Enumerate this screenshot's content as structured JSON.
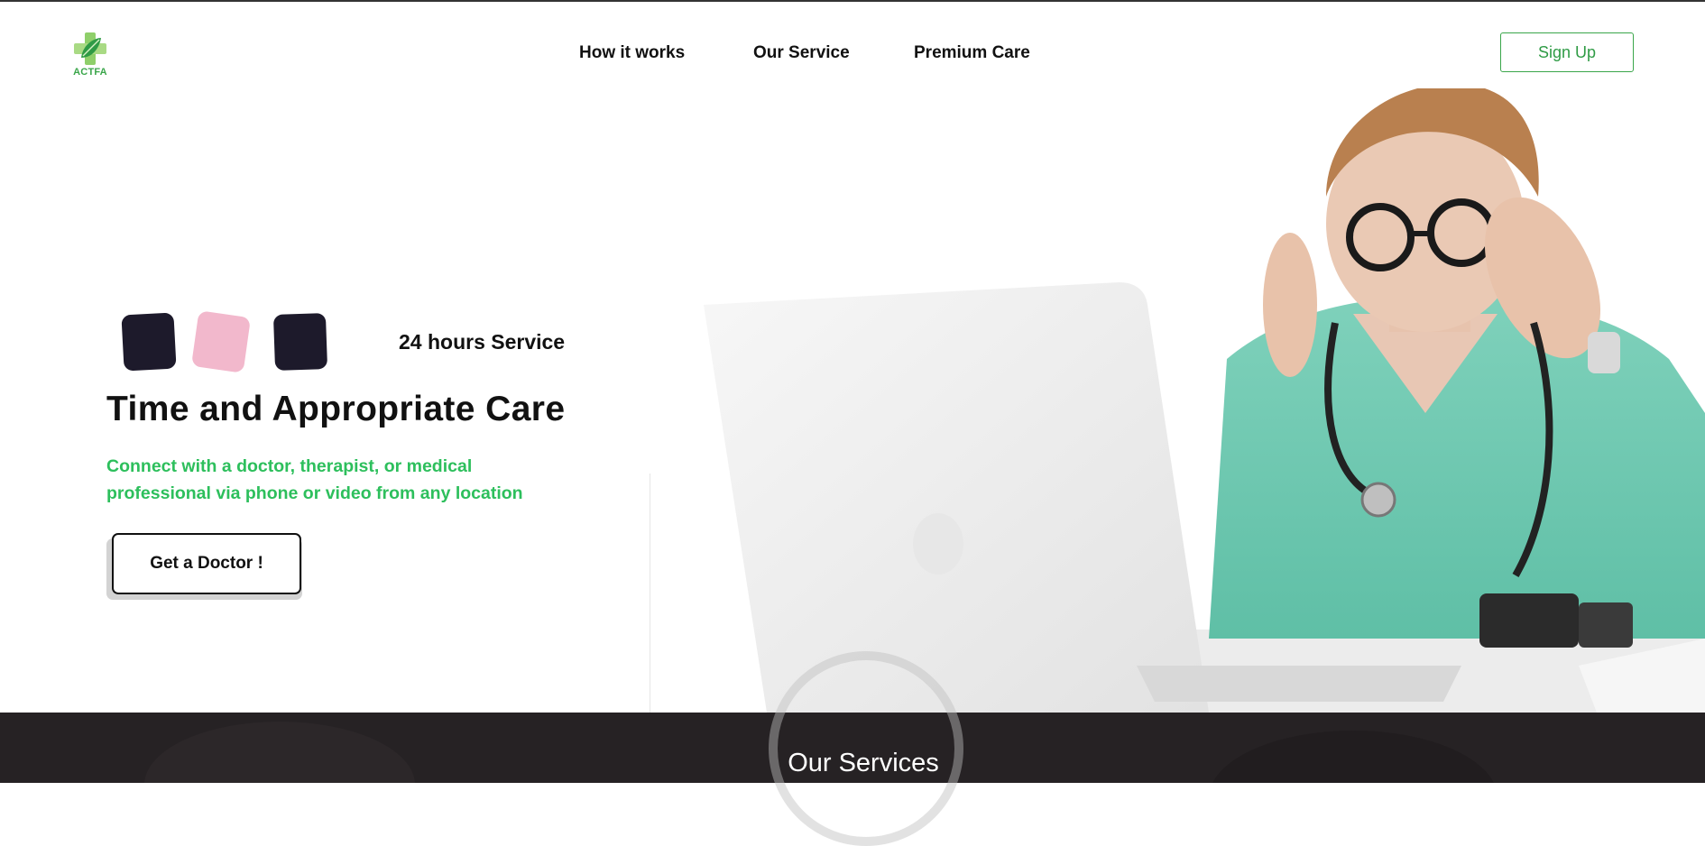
{
  "header": {
    "logo_text": "ACTFA",
    "nav": {
      "how_it_works": "How it works",
      "our_service": "Our Service",
      "premium_care": "Premium Care"
    },
    "signup_label": "Sign Up"
  },
  "hero": {
    "service_label": "24 hours Service",
    "title": "Time and Appropriate Care",
    "subtitle": "Connect with a doctor, therapist, or medical professional via phone or video from any location",
    "cta_label": "Get a Doctor !"
  },
  "services": {
    "title": "Our Services"
  },
  "colors": {
    "accent_green": "#2dbf5c",
    "signup_green": "#3aa64a",
    "dark_square": "#1d1a2b",
    "pink_square": "#f2b8cc",
    "band_dark": "#262224",
    "scrubs_teal": "#6cc7b0"
  },
  "icons": {
    "logo": "green-medical-cross-leaf-icon"
  }
}
